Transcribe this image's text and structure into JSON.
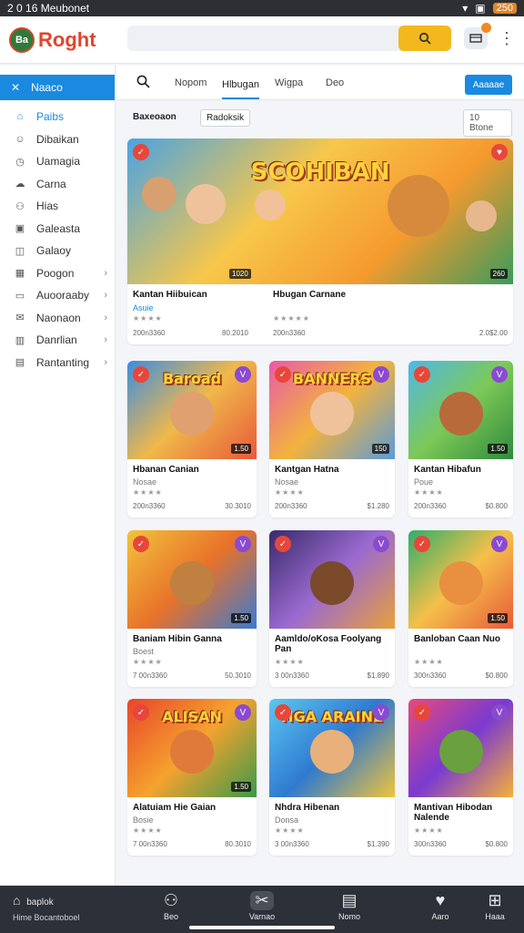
{
  "status": {
    "time": "2 0 16",
    "carrier": "Meubonet",
    "battery": "250"
  },
  "app": {
    "logo_badge": "Ba",
    "logo_text": "Roght"
  },
  "sidebar": {
    "active": "Naaco",
    "items": [
      {
        "label": "Paibs",
        "icon": "home-icon",
        "chevron": false
      },
      {
        "label": "Dibaikan",
        "icon": "user-icon",
        "chevron": false
      },
      {
        "label": "Uamagia",
        "icon": "clock-icon",
        "chevron": false
      },
      {
        "label": "Carna",
        "icon": "cloud-icon",
        "chevron": false
      },
      {
        "label": "Hias",
        "icon": "people-icon",
        "chevron": false
      },
      {
        "label": "Galeasta",
        "icon": "gallery-icon",
        "chevron": false
      },
      {
        "label": "Galaoy",
        "icon": "game-icon",
        "chevron": false
      },
      {
        "label": "Poogon",
        "icon": "grid-icon",
        "chevron": true
      },
      {
        "label": "Auooraaby",
        "icon": "card-icon",
        "chevron": true
      },
      {
        "label": "Naonaon",
        "icon": "mail-icon",
        "chevron": true
      },
      {
        "label": "Danrlian",
        "icon": "chart-icon",
        "chevron": true
      },
      {
        "label": "Rantanting",
        "icon": "doc-icon",
        "chevron": true
      }
    ]
  },
  "tabs": {
    "items": [
      "Nopom",
      "Hlbugan",
      "Wigpa",
      "Deo"
    ],
    "active_index": 1,
    "action": "Aaaaae"
  },
  "filters": {
    "label": "Baxeoaon",
    "chip": "Radoksik",
    "right": "10 Btone"
  },
  "featured": [
    {
      "art": "SCOHIBAN",
      "tag": "1020",
      "name": "Kantan Hiibuican",
      "sub": "Asuie",
      "meta_l": "200n3360",
      "meta_r": "80.2010"
    },
    {
      "name": "Hbugan Carnane",
      "tag": "260",
      "meta_l": "200n3360",
      "meta_r": "2.0$2.00"
    }
  ],
  "cards": [
    {
      "art": "Baroad",
      "name": "Hbanan Canian",
      "sub": "Nosae",
      "tag": "1.50",
      "meta_l": "200n3360",
      "meta_r": "30.3010"
    },
    {
      "art": "BANNERS",
      "name": "Kantgan Hatna",
      "sub": "Nosae",
      "tag": "150",
      "meta_l": "200n3360",
      "meta_r": "$1.280"
    },
    {
      "art": "",
      "name": "Kantan Hibafun",
      "sub": "Poue",
      "tag": "1.50",
      "meta_l": "200n3360",
      "meta_r": "$0.800"
    },
    {
      "art": "",
      "name": "Baniam Hibin Ganna",
      "sub": "Boest",
      "tag": "1.50",
      "meta_l": "7 00n3360",
      "meta_r": "50.3010"
    },
    {
      "art": "",
      "name": "Aamldo/oKosa Foolyang Pan",
      "sub": "",
      "tag": "",
      "meta_l": "3 00n3360",
      "meta_r": "$1.890"
    },
    {
      "art": "",
      "name": "Banloban Caan Nuo",
      "sub": "",
      "tag": "1.50",
      "meta_l": "300n3360",
      "meta_r": "$0.800"
    },
    {
      "art": "ALISAN",
      "name": "Alatuiam Hie Gaian",
      "sub": "Bosie",
      "tag": "1.50",
      "meta_l": "7 00n3360",
      "meta_r": "80.3010"
    },
    {
      "art": "HGA ARAINE",
      "name": "Nhdra Hibenan",
      "sub": "Donsa",
      "tag": "",
      "meta_l": "3 00n3360",
      "meta_r": "$1.390"
    },
    {
      "art": "",
      "name": "Mantivan Hibodan Nalende",
      "sub": "",
      "tag": "",
      "meta_l": "300n3360",
      "meta_r": "$0.800"
    }
  ],
  "bottom_nav": {
    "home_label": "baplok",
    "home_sub": "Hime Bocantoboel",
    "items": [
      {
        "label": "Beo",
        "icon": "bag-icon"
      },
      {
        "label": "Varnao",
        "icon": "controller-icon"
      },
      {
        "label": "Nomo",
        "icon": "list-icon"
      },
      {
        "label": "Aaro",
        "icon": "heart-icon"
      },
      {
        "label": "Haaa",
        "icon": "grid-icon"
      }
    ]
  },
  "colors": {
    "accent": "#1a8ae0",
    "search_button": "#f2b81d",
    "logo": "#e0452f",
    "nav_bg": "#2c3038"
  }
}
